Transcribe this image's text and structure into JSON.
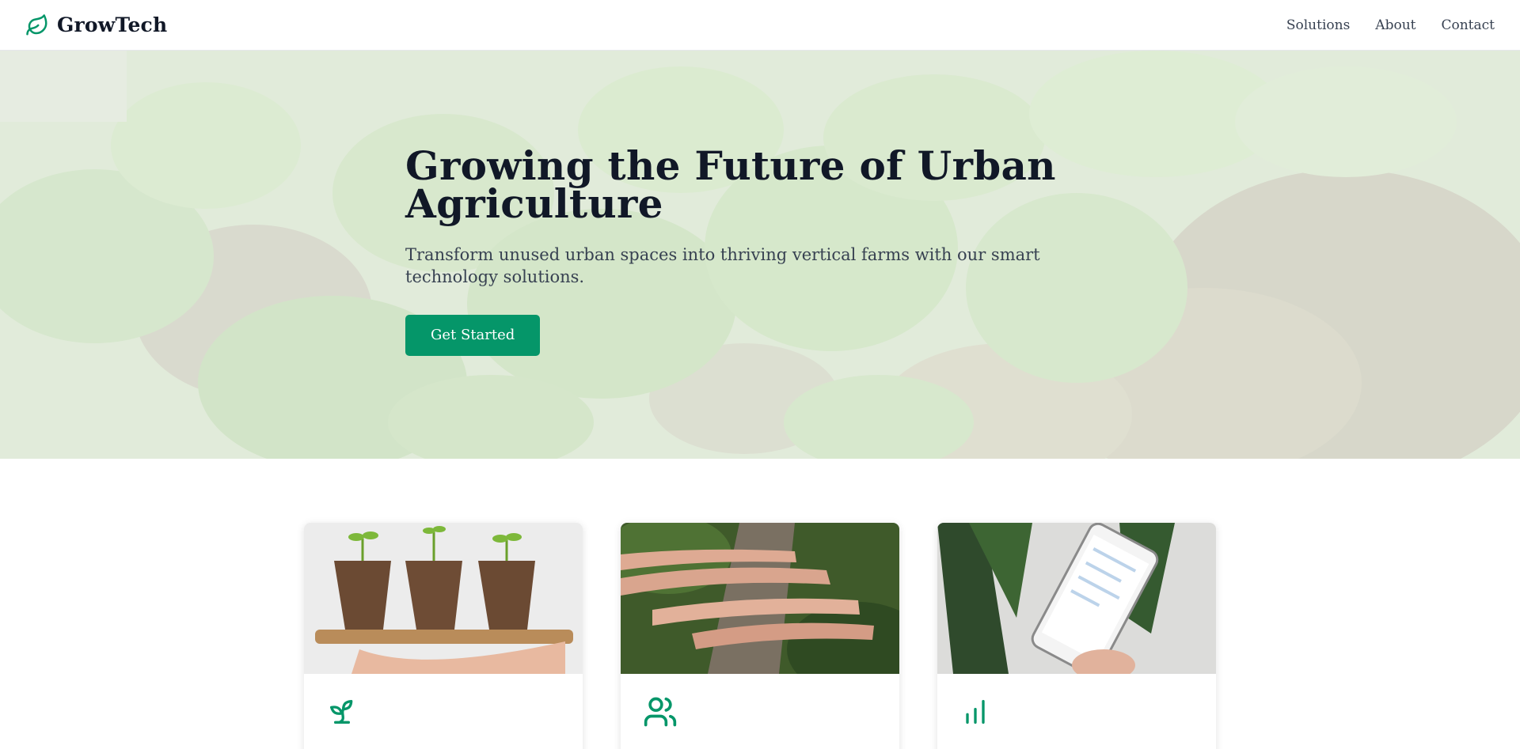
{
  "brand": {
    "name": "GrowTech",
    "icon": "leaf-icon",
    "accent": "#059669"
  },
  "nav": {
    "links": [
      "Solutions",
      "About",
      "Contact"
    ]
  },
  "hero": {
    "title": "Growing the Future of Urban Agriculture",
    "subtitle": "Transform unused urban spaces into thriving vertical farms with our smart technology solutions.",
    "cta": "Get Started"
  },
  "cards": [
    {
      "image": "seedlings-in-pots-photo",
      "icon": "sprout-icon",
      "title": ""
    },
    {
      "image": "hands-on-log-photo",
      "icon": "users-icon",
      "title": ""
    },
    {
      "image": "phone-analytics-photo",
      "icon": "bar-chart-icon",
      "title": ""
    }
  ]
}
